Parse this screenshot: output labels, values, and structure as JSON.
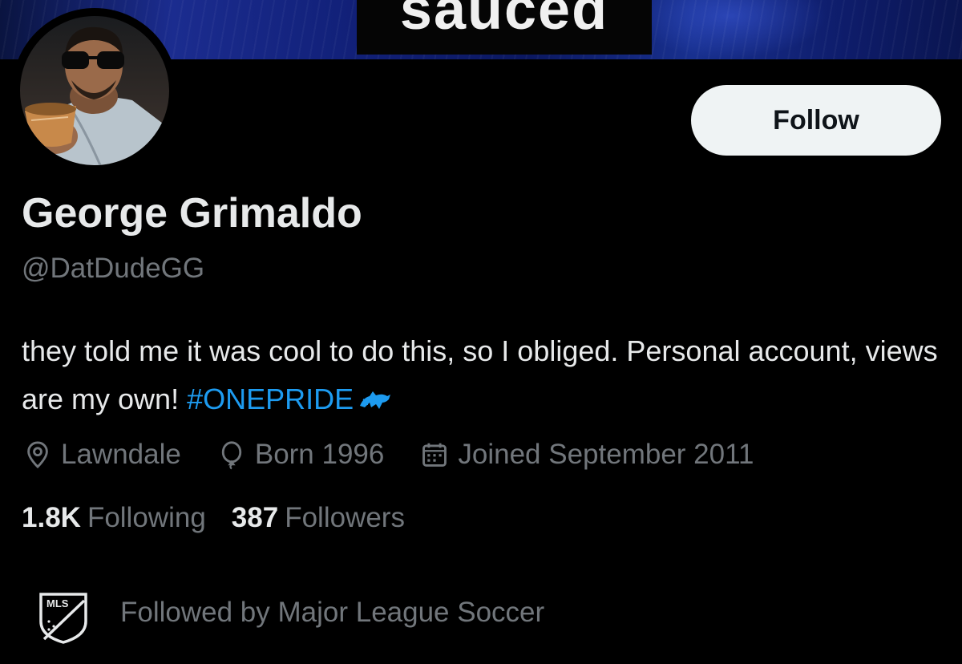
{
  "banner": {
    "caption": "sauced"
  },
  "profile": {
    "name": "George Grimaldo",
    "handle": "@DatDudeGG",
    "follow_label": "Follow",
    "bio_text": "they told me it was cool to do this, so I obliged. Personal account, views are my own!",
    "bio_hashtag": "#ONEPRIDE",
    "location": "Lawndale",
    "birth": "Born 1996",
    "joined": "Joined September 2011"
  },
  "stats": {
    "following_count": "1.8K",
    "following_label": "Following",
    "followers_count": "387",
    "followers_label": "Followers"
  },
  "followed_by": {
    "logo_text": "MLS",
    "text": "Followed by Major League Soccer"
  },
  "colors": {
    "accent": "#1d9bf0",
    "secondary_text": "#71767b",
    "primary_text": "#e7e9ea",
    "button_bg": "#eff3f4"
  }
}
